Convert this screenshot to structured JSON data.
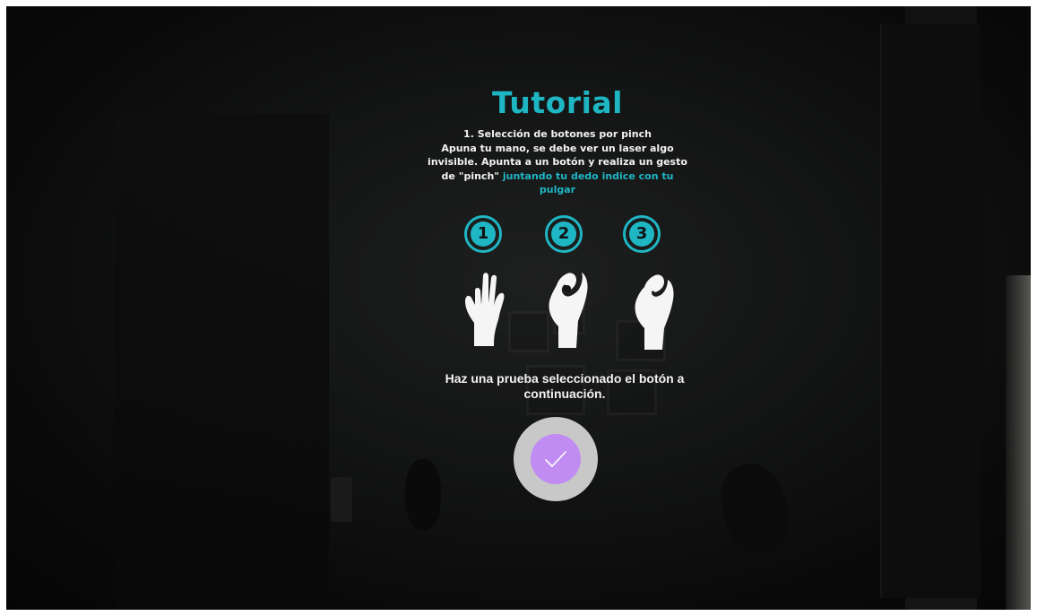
{
  "tutorial": {
    "title": "Tutorial",
    "step_heading": "1. Selección de botones por pinch",
    "description_line1": "Apuna tu mano, se debe ver un laser algo",
    "description_line2": "invisible. Apunta a un botón y realiza un gesto",
    "description_line3_prefix": "de \"pinch\" ",
    "description_highlight_a": "juntando tu dedo indice con tu",
    "description_highlight_b": "pulgar",
    "steps": [
      {
        "number": "1",
        "icon": "open-hand-icon"
      },
      {
        "number": "2",
        "icon": "pinch-hand-icon"
      },
      {
        "number": "3",
        "icon": "pinch-closed-hand-icon"
      }
    ],
    "prompt_line1": "Haz una prueba seleccionado el botón a",
    "prompt_line2": "continuación.",
    "confirm_icon": "checkmark-icon"
  },
  "colors": {
    "accent": "#1fb6c4",
    "button_outer": "#c8c8c8",
    "button_inner": "#c08cf2",
    "text": "#f2f2f2"
  }
}
